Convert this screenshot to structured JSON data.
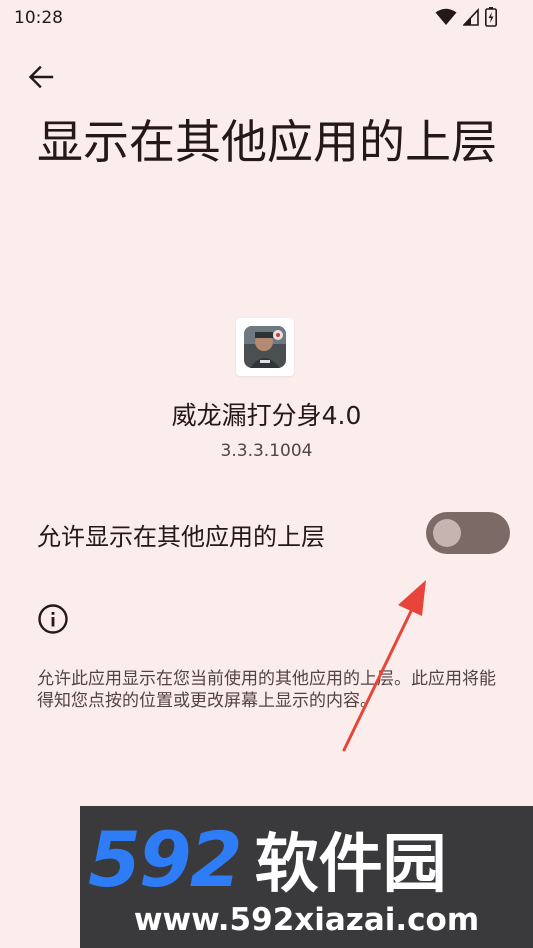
{
  "status_bar": {
    "time": "10:28"
  },
  "header": {
    "title": "显示在其他应用的上层"
  },
  "app": {
    "name": "威龙漏打分身4.0",
    "version": "3.3.3.1004"
  },
  "permission": {
    "toggle_label": "允许显示在其他应用的上层",
    "toggle_state": "off"
  },
  "info": {
    "description": "允许此应用显示在您当前使用的其他应用的上层。此应用将能得知您点按的位置或更改屏幕上显示的内容。"
  },
  "watermark": {
    "brand_digits": "592",
    "brand_cn": "软件园",
    "url": "www.592xiazai.com"
  },
  "colors": {
    "background": "#FBEDEB",
    "toggle_track": "#7C6A67",
    "annotation_arrow": "#E8443A",
    "watermark_blue": "#2E7CF6"
  },
  "icons": [
    "wifi-icon",
    "signal-icon",
    "battery-icon",
    "back-arrow-icon",
    "info-icon"
  ]
}
